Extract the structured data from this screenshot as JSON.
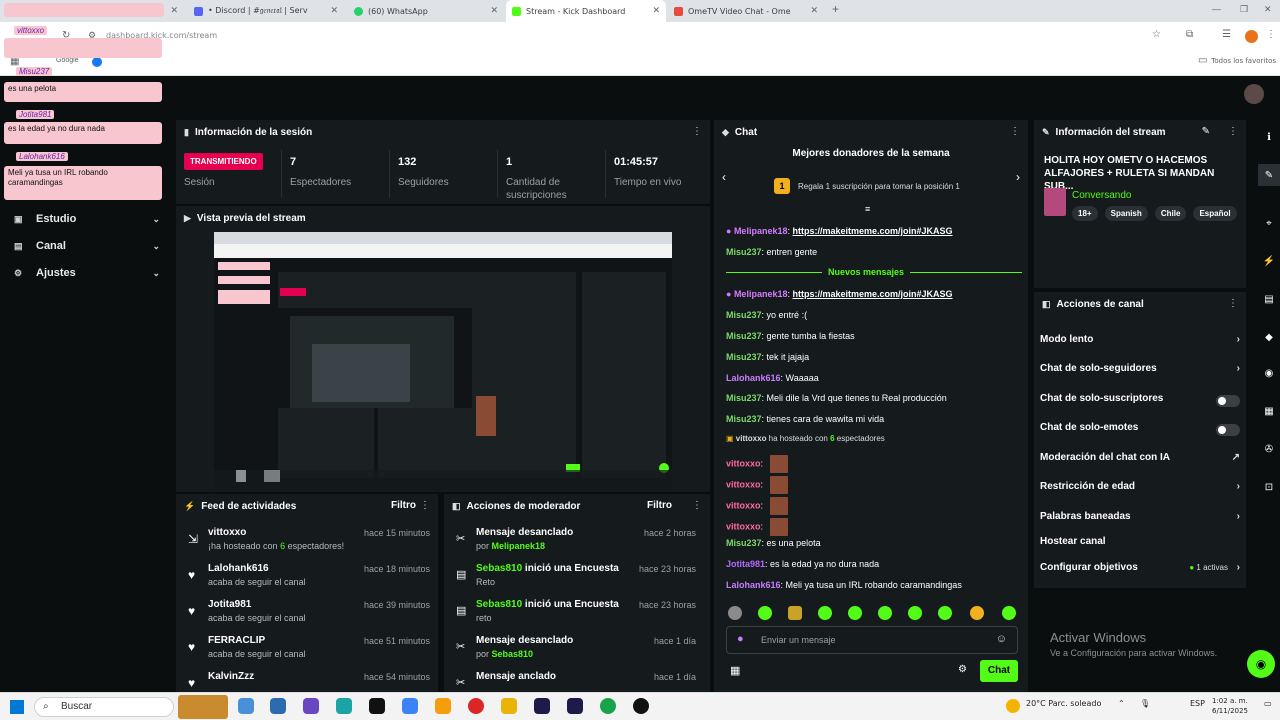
{
  "browser": {
    "tabs": [
      {
        "label": "",
        "fav": "#c0392b"
      },
      {
        "label": "• Discord | #𝔤𝔢𝔫𝔢𝔯𝔞𝔩 | Serv",
        "fav": "#5865f2"
      },
      {
        "label": "(60) WhatsApp",
        "fav": "#25d366"
      },
      {
        "label": "Stream - Kick Dashboard",
        "fav": "#53fc18"
      },
      {
        "label": "OmeTV Video Chat - Ome",
        "fav": "#e74c3c"
      }
    ],
    "url": "dashboard.kick.com/stream",
    "bookmarks_label": "Todos los favoritos",
    "bookmark_google": "Google",
    "new_tab": "+"
  },
  "overlay": {
    "name1": "vittoxxo",
    "name2": "Misu237",
    "msg2": "es una pelota",
    "name3": "Jotita981",
    "msg3": "es la edad ya no dura nada",
    "name4": "Lalohank616",
    "msg4": "Meli ya tusa un IRL robando caramandingas"
  },
  "nav": {
    "estudio": "Estudio",
    "canal": "Canal",
    "ajustes": "Ajustes"
  },
  "session": {
    "title": "Información de la sesión",
    "live_badge": "TRANSMITIENDO",
    "session_label": "Sesión",
    "viewers": "7",
    "viewers_label": "Espectadores",
    "followers": "132",
    "followers_label": "Seguidores",
    "subs": "1",
    "subs_label": "Cantidad de suscripciones",
    "uptime": "01:45:57",
    "uptime_label": "Tiempo en vivo"
  },
  "preview": {
    "title": "Vista previa del stream"
  },
  "feed": {
    "title": "Feed de actividades",
    "filter": "Filtro",
    "rows": [
      {
        "icon": "host-icon",
        "glyph": "⇲",
        "who": "vittoxxo",
        "pre": "¡ha hosteado con ",
        "hl": "6",
        "post": " espectadores!",
        "when": "hace 15 minutos"
      },
      {
        "icon": "heart-icon",
        "glyph": "♥",
        "who": "Lalohank616",
        "pre": "acaba de seguir el canal",
        "hl": "",
        "post": "",
        "when": "hace 18 minutos"
      },
      {
        "icon": "heart-icon",
        "glyph": "♥",
        "who": "Jotita981",
        "pre": "acaba de seguir el canal",
        "hl": "",
        "post": "",
        "when": "hace 39 minutos"
      },
      {
        "icon": "heart-icon",
        "glyph": "♥",
        "who": "FERRACLIP",
        "pre": "acaba de seguir el canal",
        "hl": "",
        "post": "",
        "when": "hace 51 minutos"
      },
      {
        "icon": "heart-icon",
        "glyph": "♥",
        "who": "KalvinZzz",
        "pre": "",
        "hl": "",
        "post": "",
        "when": "hace 54 minutos"
      }
    ]
  },
  "mod": {
    "title": "Acciones de moderador",
    "filter": "Filtro",
    "rows": [
      {
        "icon": "unpin-icon",
        "glyph": "✂",
        "who_hl": "",
        "who": "Mensaje desanclado",
        "pre": "por ",
        "hl": "Melipanek18",
        "when": "hace 2 horas"
      },
      {
        "icon": "poll-icon",
        "glyph": "▤",
        "who_hl": "Sebas810",
        "who": " inició una Encuesta",
        "pre": "Reto",
        "hl": "",
        "when": "hace 23 horas"
      },
      {
        "icon": "poll-icon",
        "glyph": "▤",
        "who_hl": "Sebas810",
        "who": " inició una Encuesta",
        "pre": "reto",
        "hl": "",
        "when": "hace 23 horas"
      },
      {
        "icon": "unpin-icon",
        "glyph": "✂",
        "who_hl": "",
        "who": "Mensaje desanclado",
        "pre": "por ",
        "hl": "Sebas810",
        "when": "hace 1 día"
      },
      {
        "icon": "pin-icon",
        "glyph": "✂",
        "who_hl": "",
        "who": "Mensaje anclado",
        "pre": "",
        "hl": "",
        "when": "hace 1 día"
      }
    ]
  },
  "chat": {
    "title": "Chat",
    "donors_title": "Mejores donadores de la semana",
    "donors_rank": "1",
    "donors_text": "Regala 1 suscripción para tomar la posición 1",
    "new_messages": "Nuevos mensajes",
    "lines": [
      {
        "user": "Melipanek18",
        "color": "#d67bff",
        "text": "https://makeitmeme.com/join#JKASG",
        "link": true,
        "mic": true
      },
      {
        "user": "Misu237",
        "color": "#7bd96b",
        "text": "entren gente"
      },
      {
        "user": "Melipanek18",
        "color": "#d67bff",
        "text": "https://makeitmeme.com/join#JKASG",
        "link": true,
        "mic": true
      },
      {
        "user": "Misu237",
        "color": "#7bd96b",
        "text": "yo entré :("
      },
      {
        "user": "Misu237",
        "color": "#7bd96b",
        "text": "gente tumba la fiestas"
      },
      {
        "user": "Misu237",
        "color": "#7bd96b",
        "text": "tek it jajaja"
      },
      {
        "user": "Lalohank616",
        "color": "#c77dff",
        "text": "Waaaaa"
      },
      {
        "user": "Misu237",
        "color": "#7bd96b",
        "text": "Meli dile la Vrd que tienes tu Real producción"
      },
      {
        "user": "Misu237",
        "color": "#7bd96b",
        "text": "tienes cara de wawita mi vida"
      },
      {
        "host": true,
        "user": "vittoxxo",
        "text_pre": " ha hosteado con ",
        "count": "6",
        "text_post": " espectadores"
      },
      {
        "user": "vittoxxo",
        "color": "#ff6b9a",
        "emote": true
      },
      {
        "user": "vittoxxo",
        "color": "#ff6b9a",
        "emote": true
      },
      {
        "user": "vittoxxo",
        "color": "#ff6b9a",
        "emote": true
      },
      {
        "user": "vittoxxo",
        "color": "#ff6b9a",
        "emote": true
      },
      {
        "user": "Misu237",
        "color": "#7bd96b",
        "text": "es una pelota"
      },
      {
        "user": "Jotita981",
        "color": "#b36bff",
        "text": "es la edad ya no dura nada"
      },
      {
        "user": "Lalohank616",
        "color": "#c77dff",
        "text": "Meli ya tusa un IRL robando caramandingas"
      }
    ],
    "input_placeholder": "Enviar un mensaje",
    "send_label": "Chat"
  },
  "stream_info": {
    "title": "Información del stream",
    "stream_title": "HOLITA HOY OMETV O HACEMOS ALFAJORES + RULETA SI MANDAN SUB...",
    "category": "Conversando",
    "tags": [
      "18+",
      "Spanish",
      "Chile",
      "Español"
    ]
  },
  "channel_actions": {
    "title": "Acciones de canal",
    "slow_mode": "Modo lento",
    "followers_only": "Chat de solo-seguidores",
    "subs_only": "Chat de solo-suscriptores",
    "emotes_only": "Chat de solo-emotes",
    "ai_mod": "Moderación del chat con IA",
    "age_restriction": "Restricción de edad",
    "banned_words": "Palabras baneadas",
    "host_channel": "Hostear canal",
    "goals": "Configurar objetivos",
    "goals_active": "1 activas"
  },
  "watermark": {
    "title": "Activar Windows",
    "sub": "Ve a Configuración para activar Windows."
  },
  "taskbar": {
    "search": "Buscar",
    "weather": "20°C  Parc. soleado",
    "lang": "ESP",
    "time": "1:02 a. m.",
    "date": "6/11/2025"
  },
  "colors": {
    "kick_green": "#53fc18",
    "live_red": "#e5004f",
    "panel": "#151a1c",
    "bg": "#0b0e0f"
  }
}
